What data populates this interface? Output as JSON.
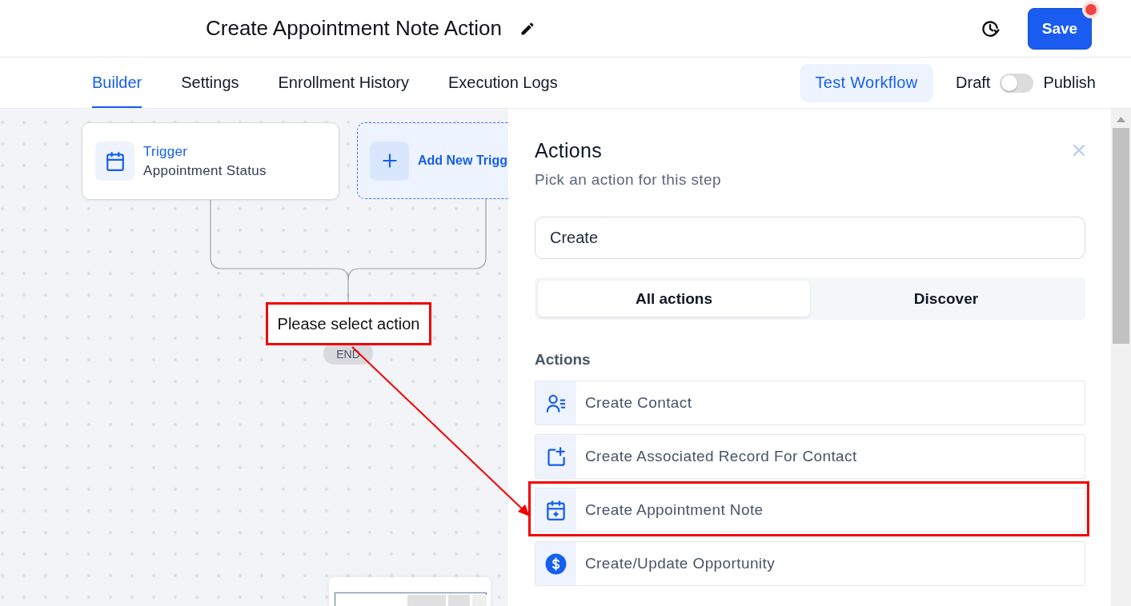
{
  "header": {
    "title": "Create Appointment Note Action",
    "save_button": "Save",
    "unsaved_changes": true
  },
  "tabs": [
    {
      "label": "Builder",
      "selected": true
    },
    {
      "label": "Settings",
      "selected": false
    },
    {
      "label": "Enrollment History",
      "selected": false
    },
    {
      "label": "Execution Logs",
      "selected": false
    }
  ],
  "test_button": "Test Workflow",
  "publish_toggle": {
    "off_label": "Draft",
    "on_label": "Publish",
    "on": false
  },
  "canvas": {
    "trigger": {
      "label": "Trigger",
      "value": "Appointment Status"
    },
    "add_trigger": {
      "label": "Add New Trigg"
    },
    "end_label": "END"
  },
  "annotation": {
    "callout": "Please select action"
  },
  "panel": {
    "title": "Actions",
    "subtitle": "Pick an action for this step",
    "search": {
      "value": "Create"
    },
    "segments": [
      {
        "label": "All actions",
        "selected": true
      },
      {
        "label": "Discover",
        "selected": false
      }
    ],
    "section_label": "Actions",
    "items": [
      {
        "label": "Create Contact",
        "highlighted": false
      },
      {
        "label": "Create Associated Record For Contact",
        "highlighted": false
      },
      {
        "label": "Create Appointment Note",
        "highlighted": true
      },
      {
        "label": "Create/Update Opportunity",
        "highlighted": false
      }
    ]
  }
}
